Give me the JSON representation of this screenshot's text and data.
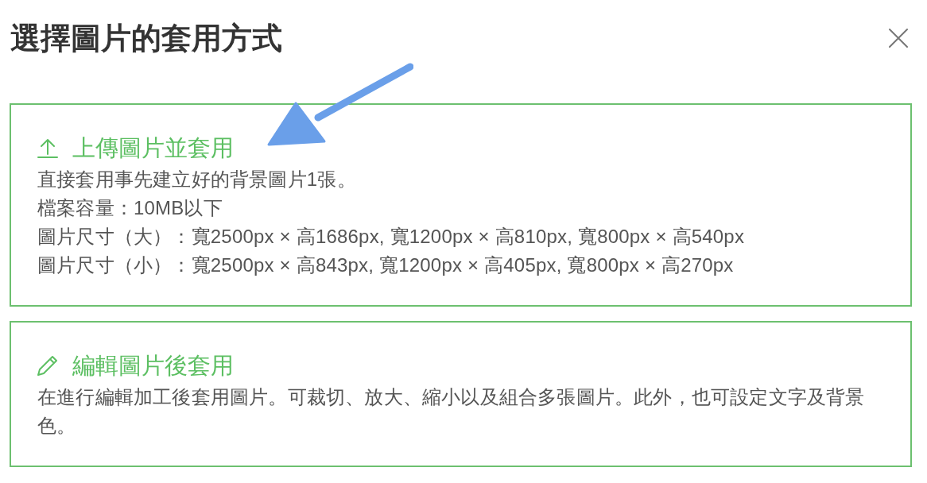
{
  "dialog": {
    "title": "選擇圖片的套用方式"
  },
  "options": [
    {
      "kind": "upload",
      "heading": "上傳圖片並套用",
      "lines": [
        "直接套用事先建立好的背景圖片1張。",
        "檔案容量：10MB以下",
        "圖片尺寸（大）：寬2500px × 高1686px, 寬1200px × 高810px, 寬800px × 高540px",
        "圖片尺寸（小）：寬2500px × 高843px, 寬1200px × 高405px, 寬800px × 高270px"
      ]
    },
    {
      "kind": "edit",
      "heading": "編輯圖片後套用",
      "lines": [
        "在進行編輯加工後套用圖片。可裁切、放大、縮小以及組合多張圖片。此外，也可設定文字及背景色。"
      ]
    }
  ]
}
